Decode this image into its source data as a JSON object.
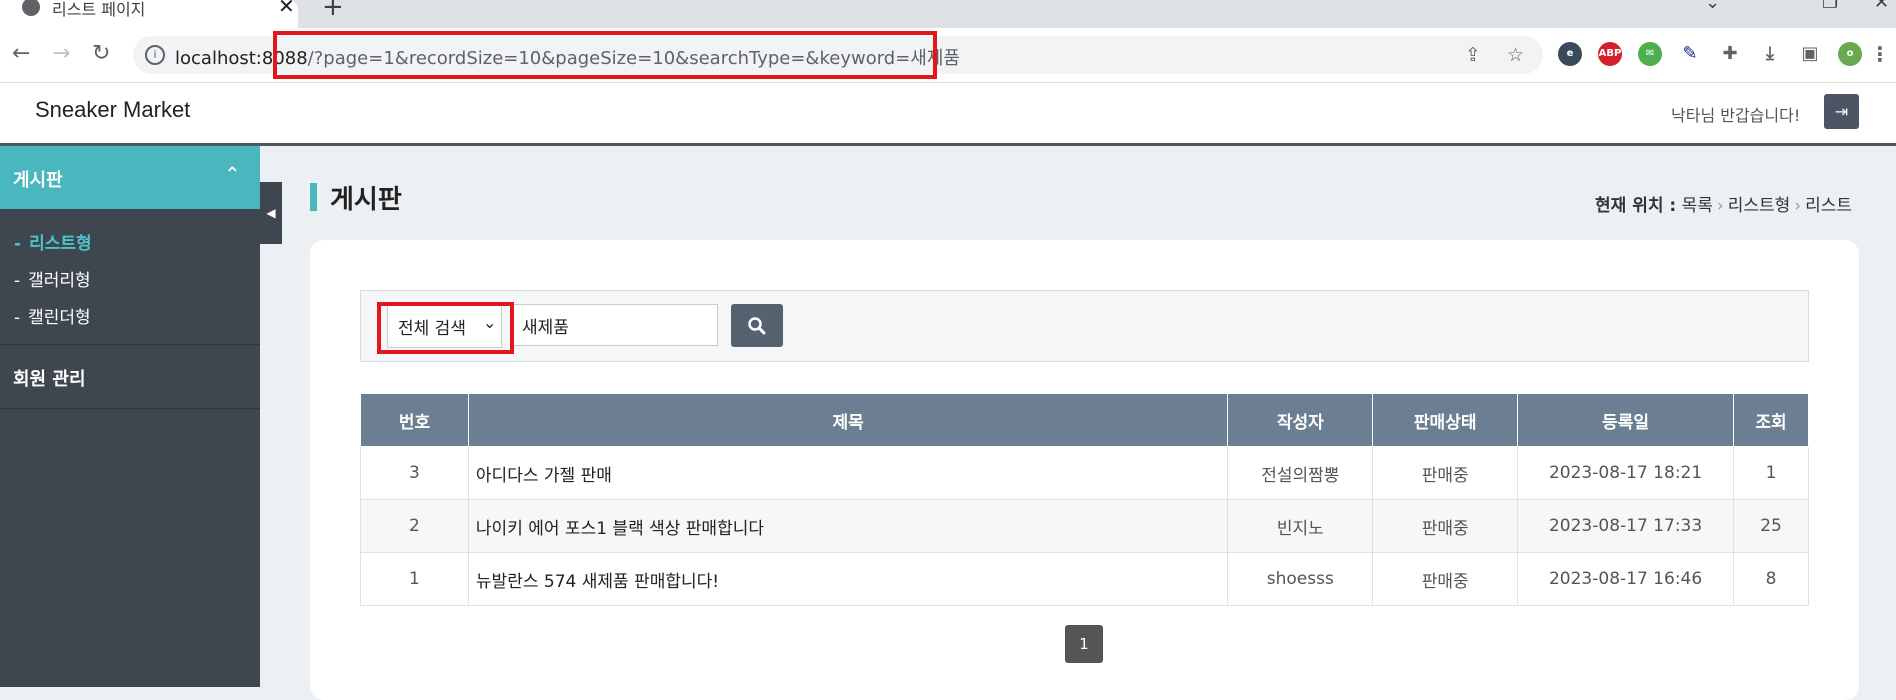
{
  "browser": {
    "tab_title": "리스트 페이지",
    "close_glyph": "✕",
    "new_tab_glyph": "+",
    "url_host": "localhost:8088",
    "url_rest": "/?page=1&recordSize=10&pageSize=10&searchType=&keyword=새제품",
    "profile_initial": "o",
    "abp_label": "ABP"
  },
  "header": {
    "brand": "Sneaker Market",
    "welcome": "낙타님 반갑습니다!"
  },
  "sidebar": {
    "section1": "게시판",
    "items": [
      {
        "label": "리스트형"
      },
      {
        "label": "갤러리형"
      },
      {
        "label": "캘린더형"
      }
    ],
    "section2": "회원 관리"
  },
  "main": {
    "page_title": "게시판",
    "breadcrumb": {
      "label": "현재 위치 :",
      "items": [
        "목록",
        "리스트형",
        "리스트"
      ]
    },
    "search": {
      "type_selected": "전체 검색",
      "keyword": "새제품"
    },
    "table": {
      "headers": [
        "번호",
        "제목",
        "작성자",
        "판매상태",
        "등록일",
        "조회"
      ],
      "rows": [
        {
          "no": "3",
          "title": "아디다스 가젤 판매",
          "author": "전설의짬뽕",
          "status": "판매중",
          "date": "2023-08-17 18:21",
          "views": "1"
        },
        {
          "no": "2",
          "title": "나이키 에어 포스1 블랙 색상 판매합니다",
          "author": "빈지노",
          "status": "판매중",
          "date": "2023-08-17 17:33",
          "views": "25"
        },
        {
          "no": "1",
          "title": "뉴발란스 574 새제품 판매합니다!",
          "author": "shoesss",
          "status": "판매중",
          "date": "2023-08-17 16:46",
          "views": "8"
        }
      ]
    },
    "pagination": {
      "current": "1"
    }
  },
  "colors": {
    "accent": "#4ab7bf",
    "sidebar": "#3e464f",
    "table_header": "#6c7f92",
    "highlight": "#e3161e"
  }
}
